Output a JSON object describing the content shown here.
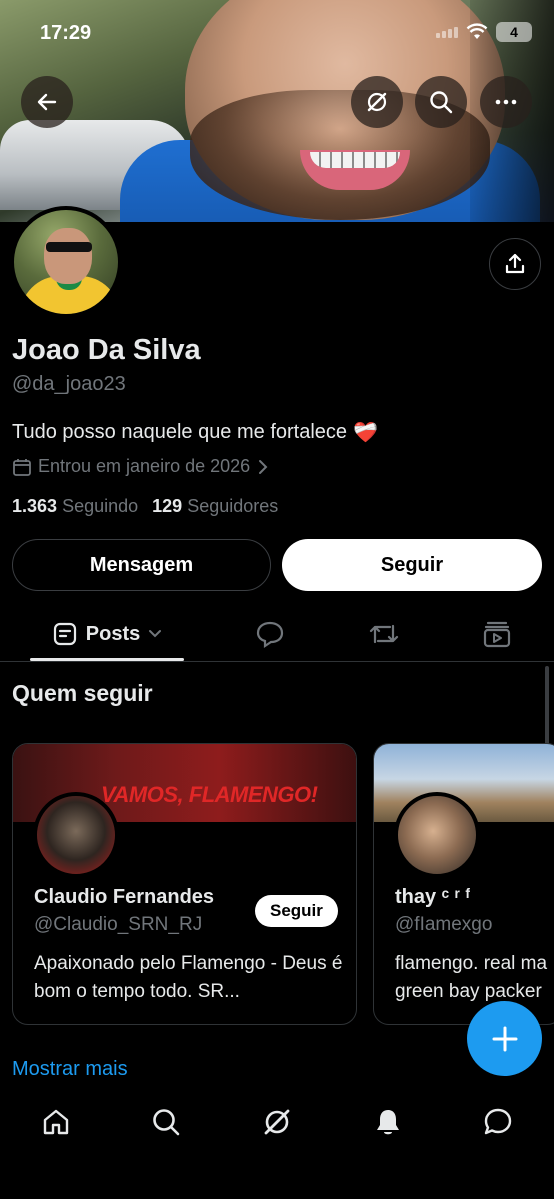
{
  "status_bar": {
    "time": "17:29",
    "battery": "4"
  },
  "profile": {
    "name": "Joao Da Silva",
    "handle": "@da_joao23",
    "bio": "Tudo posso naquele que me fortalece",
    "bio_emoji": "❤️‍🩹",
    "joined": "Entrou em janeiro de 2026",
    "following_count": "1.363",
    "following_label": "Seguindo",
    "followers_count": "129",
    "followers_label": "Seguidores"
  },
  "actions": {
    "message": "Mensagem",
    "follow": "Seguir"
  },
  "tabs": {
    "posts": "Posts"
  },
  "who_to_follow": {
    "title": "Quem seguir",
    "show_more": "Mostrar mais",
    "cards": [
      {
        "banner_text": "VAMOS, FLAMENGO!",
        "name": "Claudio Fernandes",
        "handle": "@Claudio_SRN_RJ",
        "bio": "Apaixonado pelo Flamengo - Deus é bom o tempo todo. SR...",
        "follow": "Seguir"
      },
      {
        "name": "thay ᶜ ʳ ᶠ",
        "handle": "@fIamexgo",
        "bio_line1": "flamengo. real ma",
        "bio_line2": "green bay packer"
      }
    ]
  },
  "colors": {
    "accent": "#1d9bf0",
    "muted": "#71767b",
    "background": "#000000"
  },
  "icons": {
    "back": "arrow-left-icon",
    "grok": "grok-icon",
    "search": "search-icon",
    "more": "more-icon",
    "share": "share-icon",
    "calendar": "calendar-icon",
    "compose": "plus-icon",
    "nav": [
      "home-icon",
      "search-icon",
      "grok-icon",
      "bell-icon",
      "chat-icon"
    ]
  }
}
